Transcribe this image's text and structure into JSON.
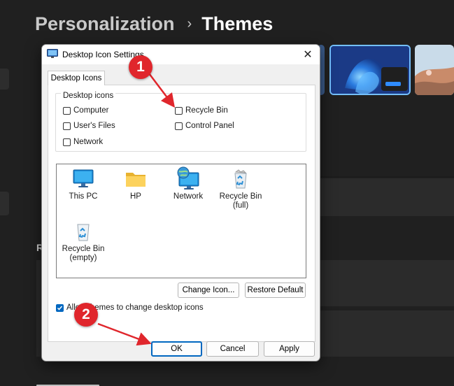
{
  "settings": {
    "breadcrumb_parent": "Personalization",
    "breadcrumb_separator": "›",
    "breadcrumb_current": "Themes",
    "section_letter": "R"
  },
  "dialog": {
    "title": "Desktop Icon Settings",
    "close_glyph": "✕",
    "tab_label": "Desktop Icons",
    "group_label": "Desktop icons",
    "checkboxes": [
      {
        "label": "Computer",
        "checked": false
      },
      {
        "label": "User's Files",
        "checked": false
      },
      {
        "label": "Network",
        "checked": false
      },
      {
        "label": "Recycle Bin",
        "checked": false
      },
      {
        "label": "Control Panel",
        "checked": false
      }
    ],
    "icons": [
      {
        "line1": "This PC",
        "line2": "",
        "icon": "monitor-icon"
      },
      {
        "line1": "HP",
        "line2": "",
        "icon": "folder-icon"
      },
      {
        "line1": "Network",
        "line2": "",
        "icon": "network-icon"
      },
      {
        "line1": "Recycle Bin",
        "line2": "(full)",
        "icon": "recycle-bin-full-icon"
      },
      {
        "line1": "Recycle Bin",
        "line2": "(empty)",
        "icon": "recycle-bin-empty-icon"
      }
    ],
    "change_icon_label": "Change Icon...",
    "restore_default_label": "Restore Default",
    "allow_themes": {
      "label": "Allow themes to change desktop icons",
      "checked": true
    },
    "ok_label": "OK",
    "cancel_label": "Cancel",
    "apply_label": "Apply"
  },
  "annotations": {
    "step1": "1",
    "step2": "2",
    "color": "#e0262c"
  },
  "colors": {
    "accent": "#0067c0",
    "background": "#202020"
  }
}
